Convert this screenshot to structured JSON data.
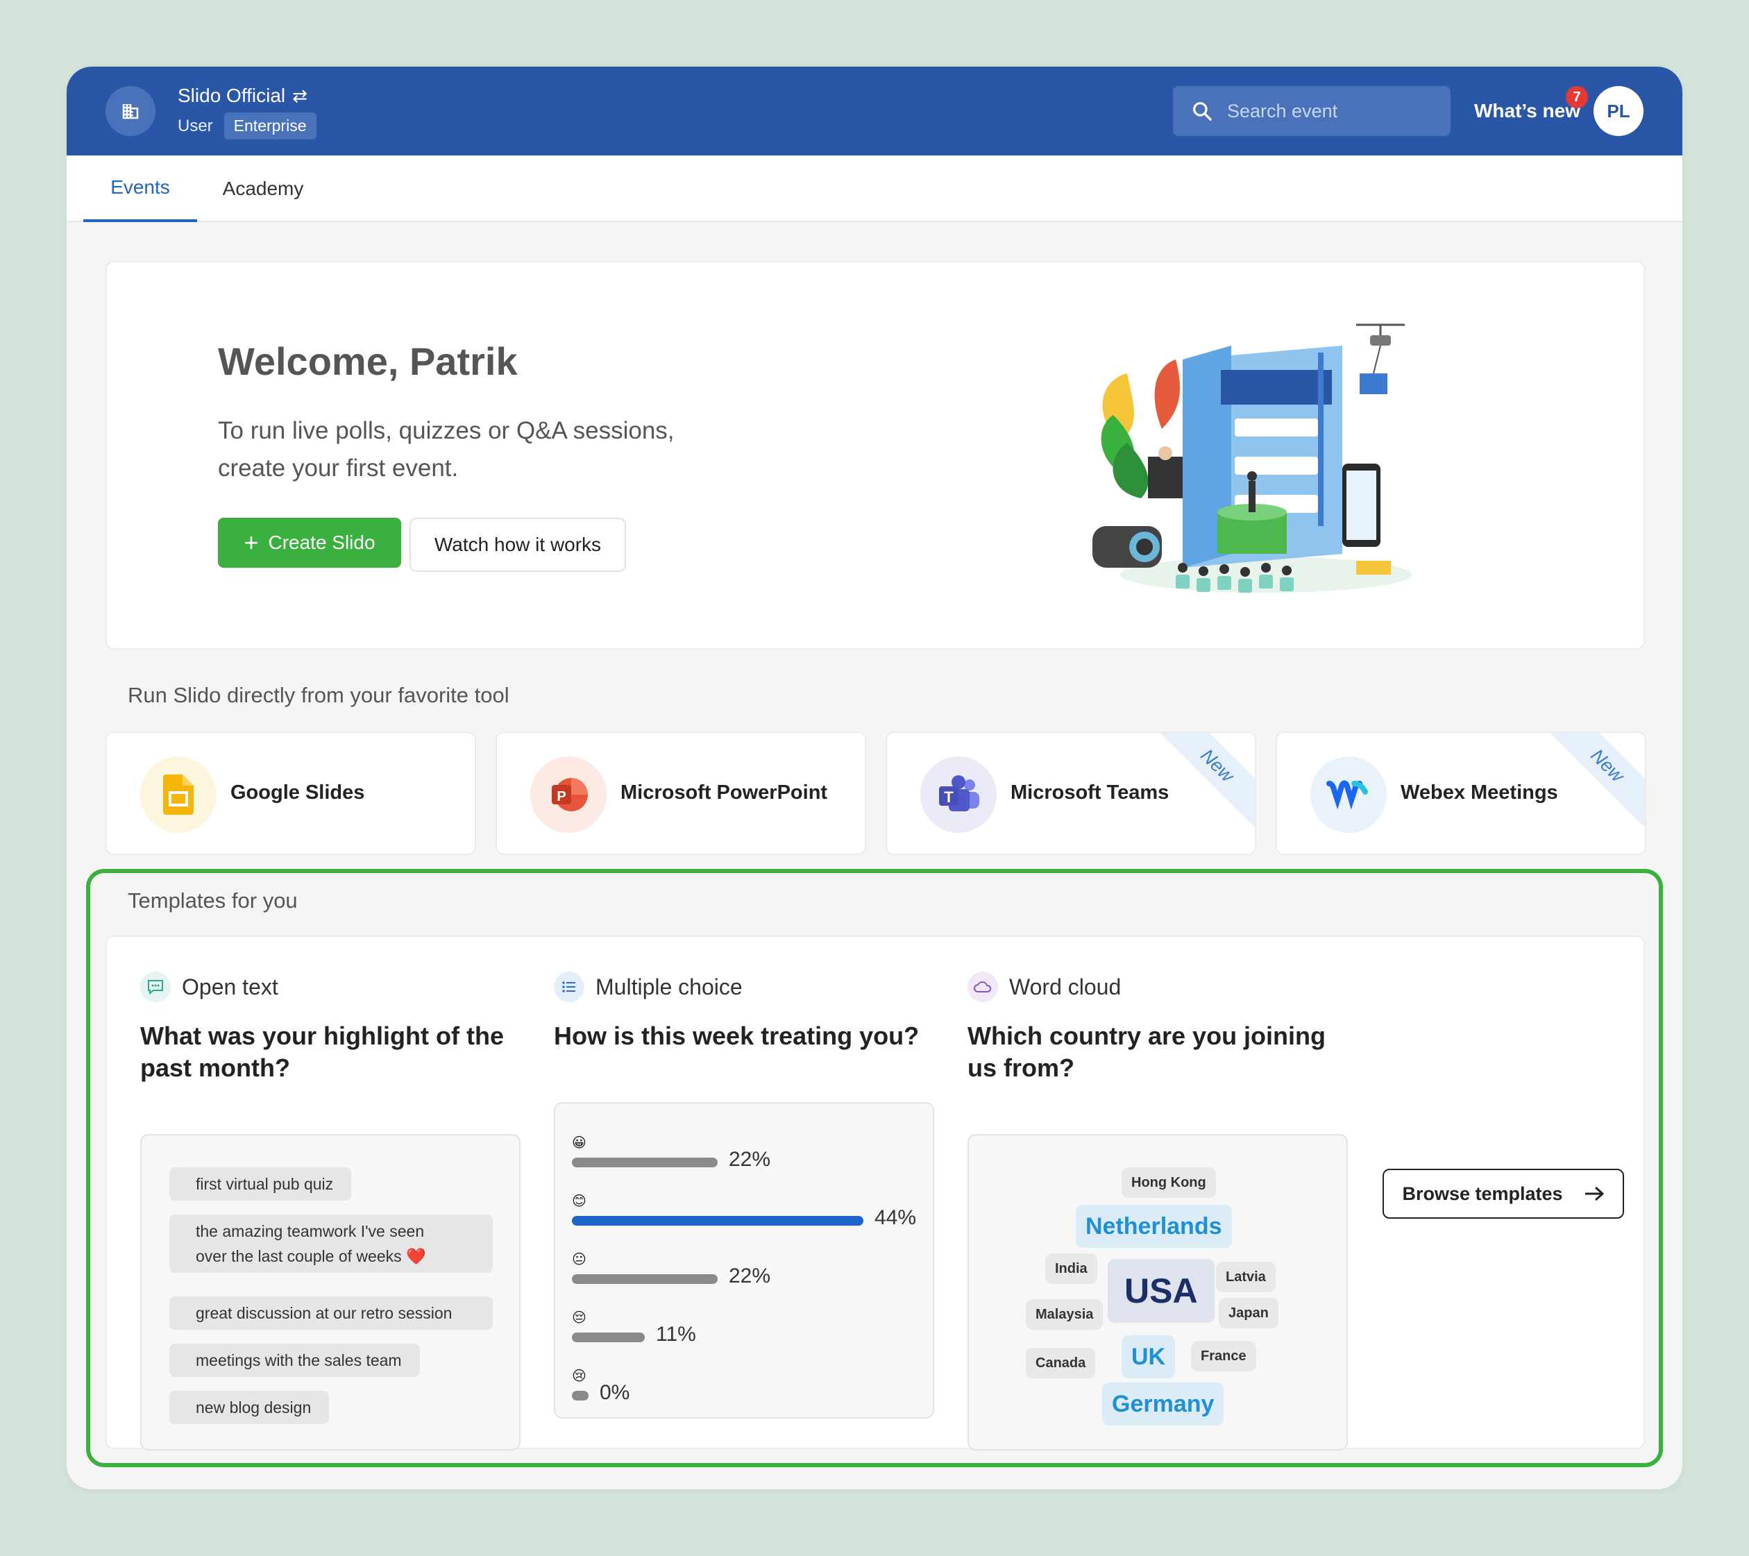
{
  "header": {
    "org_name": "Slido Official",
    "role": "User",
    "plan": "Enterprise",
    "search_placeholder": "Search event",
    "whats_new": "What’s new",
    "notification_count": "7",
    "avatar_initials": "PL"
  },
  "tabs": [
    {
      "label": "Events",
      "active": true
    },
    {
      "label": "Academy",
      "active": false
    }
  ],
  "welcome": {
    "title": "Welcome, Patrik",
    "line1": "To run live polls, quizzes or Q&A sessions,",
    "line2": "create your first event.",
    "create_button": "Create Slido",
    "watch_button": "Watch how it works"
  },
  "tools": {
    "title": "Run Slido directly from your favorite tool",
    "items": [
      {
        "label": "Google Slides",
        "icon": "google-slides-icon",
        "badge": ""
      },
      {
        "label": "Microsoft PowerPoint",
        "icon": "powerpoint-icon",
        "badge": ""
      },
      {
        "label": "Microsoft Teams",
        "icon": "teams-icon",
        "badge": "New"
      },
      {
        "label": "Webex Meetings",
        "icon": "webex-icon",
        "badge": "New"
      }
    ]
  },
  "templates": {
    "title": "Templates for you",
    "open_text": {
      "type": "Open text",
      "question": "What was your highlight of the past month?",
      "answers": [
        "first virtual pub quiz",
        "the amazing teamwork I've seen",
        "over the last couple of weeks ❤️",
        "great discussion at our retro session",
        "meetings with the sales team",
        "new blog design"
      ]
    },
    "multiple_choice": {
      "type": "Multiple choice",
      "question": "How is this week treating you?",
      "options": [
        {
          "emoji": "😀",
          "percent": "22%",
          "value": 22
        },
        {
          "emoji": "😊",
          "percent": "44%",
          "value": 44
        },
        {
          "emoji": "😐",
          "percent": "22%",
          "value": 22
        },
        {
          "emoji": "😔",
          "percent": "11%",
          "value": 11
        },
        {
          "emoji": "😢",
          "percent": "0%",
          "value": 0
        }
      ],
      "highlight_color": "#1e63c7"
    },
    "word_cloud": {
      "type": "Word cloud",
      "question": "Which country are you joining us from?",
      "words": [
        "Hong Kong",
        "Netherlands",
        "India",
        "USA",
        "Latvia",
        "Malaysia",
        "Japan",
        "UK",
        "Canada",
        "France",
        "Germany"
      ]
    },
    "browse_button": "Browse templates"
  },
  "colors": {
    "brand_blue": "#2a56a8",
    "accent_green": "#3ab03e",
    "link_blue": "#1e63c7"
  }
}
